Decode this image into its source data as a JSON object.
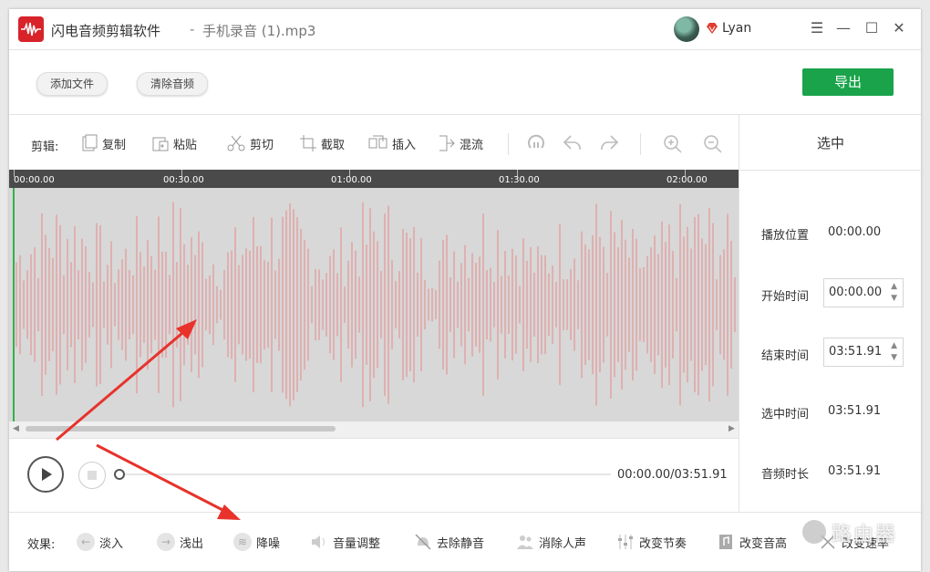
{
  "titlebar": {
    "app_name": "闪电音频剪辑软件",
    "separator": "-",
    "file_name": "手机录音 (1).mp3",
    "username": "Lyan",
    "controls": [
      "menu",
      "minimize",
      "maximize",
      "close"
    ]
  },
  "toolbar": {
    "add_file": "添加文件",
    "clear_audio": "清除音频",
    "export": "导出",
    "export_color": "#1aa34a"
  },
  "editbar": {
    "label": "剪辑:",
    "tools": [
      {
        "label": "复制",
        "icon": "copy-icon"
      },
      {
        "label": "粘贴",
        "icon": "paste-icon"
      },
      {
        "label": "剪切",
        "icon": "scissors-icon"
      },
      {
        "label": "截取",
        "icon": "crop-icon"
      },
      {
        "label": "插入",
        "icon": "insert-icon"
      },
      {
        "label": "混流",
        "icon": "mix-icon"
      }
    ],
    "icon_buttons": [
      "reset-icon",
      "undo-icon",
      "redo-icon",
      "zoom-in-icon",
      "zoom-out-icon"
    ]
  },
  "timeline": {
    "ticks": [
      "00:00.00",
      "00:30.00",
      "01:00.00",
      "01:30.00",
      "02:00.00"
    ]
  },
  "waveform": {
    "color": "#e39a9a",
    "background": "#d8d8d8"
  },
  "panel": {
    "title": "选中",
    "play_position_label": "播放位置",
    "play_position": "00:00.00",
    "start_label": "开始时间",
    "start_value": "00:00.00",
    "end_label": "结束时间",
    "end_value": "03:51.91",
    "selected_label": "选中时间",
    "selected_value": "03:51.91",
    "duration_label": "音频时长",
    "duration_value": "03:51.91"
  },
  "playback": {
    "time": "00:00.00/03:51.91",
    "progress": 0
  },
  "effects": {
    "label": "效果:",
    "items": [
      {
        "label": "淡入",
        "icon": "fade-in-icon"
      },
      {
        "label": "浅出",
        "icon": "fade-out-icon"
      },
      {
        "label": "降噪",
        "icon": "denoise-icon"
      },
      {
        "label": "音量调整",
        "icon": "volume-icon"
      },
      {
        "label": "去除静音",
        "icon": "mute-remove-icon"
      },
      {
        "label": "消除人声",
        "icon": "vocal-remove-icon"
      },
      {
        "label": "改变节奏",
        "icon": "tempo-icon"
      },
      {
        "label": "改变音高",
        "icon": "pitch-icon"
      },
      {
        "label": "改变速率",
        "icon": "speed-icon"
      }
    ]
  },
  "watermark": {
    "text": "路由器"
  }
}
